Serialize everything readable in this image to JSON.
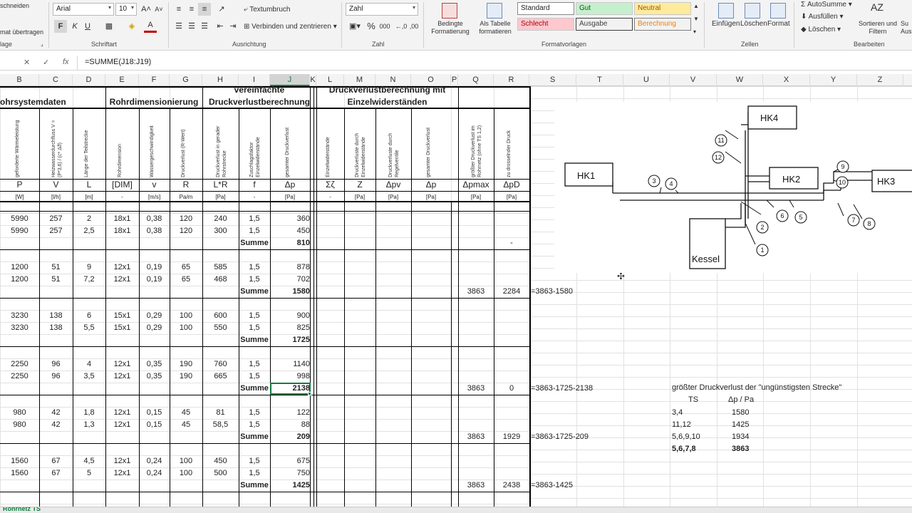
{
  "ribbon": {
    "clipboard": {
      "cut_label": "schneiden",
      "paste_format_label": "mat übertragen",
      "group": "lage"
    },
    "font": {
      "name": "Arial",
      "size": "10",
      "group": "Schriftart",
      "bold": "F",
      "italic": "K",
      "underline": "U"
    },
    "align": {
      "wrap": "Textumbruch",
      "merge": "Verbinden und zentrieren",
      "group": "Ausrichtung"
    },
    "number": {
      "format": "Zahl",
      "group": "Zahl"
    },
    "styles": {
      "cond": "Bedingte Formatierung",
      "table": "Als Tabelle formatieren",
      "standard": "Standard",
      "gut": "Gut",
      "neutral": "Neutral",
      "schlecht": "Schlecht",
      "ausgabe": "Ausgabe",
      "berechnung": "Berechnung",
      "group": "Formatvorlagen"
    },
    "cells": {
      "insert": "Einfügen",
      "delete": "Löschen",
      "format": "Format",
      "group": "Zellen"
    },
    "edit": {
      "autosum": "AutoSumme",
      "fill": "Ausfüllen",
      "clear": "Löschen",
      "sort": "Sortieren und Filtern",
      "search": "Su Aus",
      "group": "Bearbeiten"
    }
  },
  "formula_bar": {
    "formula": "=SUMME(J18:J19)"
  },
  "columns": [
    "B",
    "C",
    "D",
    "E",
    "F",
    "G",
    "H",
    "I",
    "J",
    "K",
    "L",
    "M",
    "N",
    "O",
    "P",
    "Q",
    "R",
    "S",
    "T",
    "U",
    "V",
    "W",
    "X",
    "Y",
    "Z"
  ],
  "headers": {
    "g1": "ohrsystemdaten",
    "g2": "Rohrdimensionierung",
    "g3a": "vereinfachte",
    "g3b": "Druckverlustberechnung",
    "g4a": "Druckverlustberechnung mit",
    "g4b": "Einzelwiderständen",
    "vB": "geforderte Wärmeleistung",
    "vC": "Heizwasserdurchfluss V = (P*3,6) / (c* Δϑ)",
    "vD": "Länge der Teilstrecke",
    "vE": "Rohrdimension",
    "vF": "Wassergeschwindigkeit",
    "vG": "Druckverlust (R-Wert)",
    "vH": "Druckverlust in gerader Rohrstrecke",
    "vI": "Zuschlagsfaktor Einzelwiderstände",
    "vJ": "gesamter Druckverlust",
    "vL": "Einzelwiderstände",
    "vM": "Druckverluste durch Einzelwiderstände",
    "vN": "Druckverluste durch Regelventile",
    "vO": "gesamter Druckverlust",
    "vQ": "größter Druckverlust im Rohrnetz (ohne TS 1,2)",
    "vR": "zu drosselnder Druck",
    "sym": [
      "P",
      "V",
      "L",
      "[DIM]",
      "v",
      "R",
      "L*R",
      "f",
      "Δp",
      "Σζ",
      "Z",
      "Δpv",
      "Δp",
      "Δpmax",
      "ΔpD"
    ],
    "unit": [
      "[W]",
      "[l/h]",
      "[m]",
      "-",
      "[m/s]",
      "Pa/m",
      "[Pa]",
      "-",
      "[Pa]",
      "-",
      "[Pa]",
      "[Pa]",
      "[Pa]",
      "[Pa]",
      "[Pa]"
    ]
  },
  "rows": [
    {
      "P": "5990",
      "V": "257",
      "L": "2",
      "DIM": "18x1",
      "v": "0,38",
      "R": "120",
      "LR": "240",
      "f": "1,5",
      "dp": "360"
    },
    {
      "P": "5990",
      "V": "257",
      "L": "2,5",
      "DIM": "18x1",
      "v": "0,38",
      "R": "120",
      "LR": "300",
      "f": "1,5",
      "dp": "450"
    },
    {
      "sum": "Summe",
      "dp": "810",
      "dpD": "-"
    },
    {
      "P": "1200",
      "V": "51",
      "L": "9",
      "DIM": "12x1",
      "v": "0,19",
      "R": "65",
      "LR": "585",
      "f": "1,5",
      "dp": "878"
    },
    {
      "P": "1200",
      "V": "51",
      "L": "7,2",
      "DIM": "12x1",
      "v": "0,19",
      "R": "65",
      "LR": "468",
      "f": "1,5",
      "dp": "702"
    },
    {
      "sum": "Summe",
      "dp": "1580",
      "dpmax": "3863",
      "dpD": "2284",
      "note": "=3863-1580"
    },
    {
      "P": "3230",
      "V": "138",
      "L": "6",
      "DIM": "15x1",
      "v": "0,29",
      "R": "100",
      "LR": "600",
      "f": "1,5",
      "dp": "900"
    },
    {
      "P": "3230",
      "V": "138",
      "L": "5,5",
      "DIM": "15x1",
      "v": "0,29",
      "R": "100",
      "LR": "550",
      "f": "1,5",
      "dp": "825"
    },
    {
      "sum": "Summe",
      "dp": "1725"
    },
    {
      "P": "2250",
      "V": "96",
      "L": "4",
      "DIM": "12x1",
      "v": "0,35",
      "R": "190",
      "LR": "760",
      "f": "1,5",
      "dp": "1140"
    },
    {
      "P": "2250",
      "V": "96",
      "L": "3,5",
      "DIM": "12x1",
      "v": "0,35",
      "R": "190",
      "LR": "665",
      "f": "1,5",
      "dp": "998"
    },
    {
      "sum": "Summe",
      "dp": "2138",
      "dpmax": "3863",
      "dpD": "0",
      "note": "=3863-1725-2138"
    },
    {
      "P": "980",
      "V": "42",
      "L": "1,8",
      "DIM": "12x1",
      "v": "0,15",
      "R": "45",
      "LR": "81",
      "f": "1,5",
      "dp": "122"
    },
    {
      "P": "980",
      "V": "42",
      "L": "1,3",
      "DIM": "12x1",
      "v": "0,15",
      "R": "45",
      "LR": "58,5",
      "f": "1,5",
      "dp": "88"
    },
    {
      "sum": "Summe",
      "dp": "209",
      "dpmax": "3863",
      "dpD": "1929",
      "note": "=3863-1725-209"
    },
    {
      "P": "1560",
      "V": "67",
      "L": "4,5",
      "DIM": "12x1",
      "v": "0,24",
      "R": "100",
      "LR": "450",
      "f": "1,5",
      "dp": "675"
    },
    {
      "P": "1560",
      "V": "67",
      "L": "5",
      "DIM": "12x1",
      "v": "0,24",
      "R": "100",
      "LR": "500",
      "f": "1,5",
      "dp": "750"
    },
    {
      "sum": "Summe",
      "dp": "1425",
      "dpmax": "3863",
      "dpD": "2438",
      "note": "=3863-1425"
    }
  ],
  "side_table": {
    "title": "größter Druckverlust der \"ungünstigsten Strecke\"",
    "h1": "TS",
    "h2": "Δp / Pa",
    "rows": [
      [
        "3,4",
        "1580"
      ],
      [
        "11,12",
        "1425"
      ],
      [
        "5,6,9,10",
        "1934"
      ],
      [
        "5,6,7,8",
        "3863"
      ]
    ]
  },
  "diagram": {
    "hk1": "HK1",
    "hk2": "HK2",
    "hk3": "HK3",
    "hk4": "HK4",
    "kessel": "Kessel",
    "nums": [
      "1",
      "2",
      "3",
      "4",
      "5",
      "6",
      "7",
      "8",
      "9",
      "10",
      "11",
      "12"
    ]
  },
  "sheet_tab": "Rohrnetz TS"
}
